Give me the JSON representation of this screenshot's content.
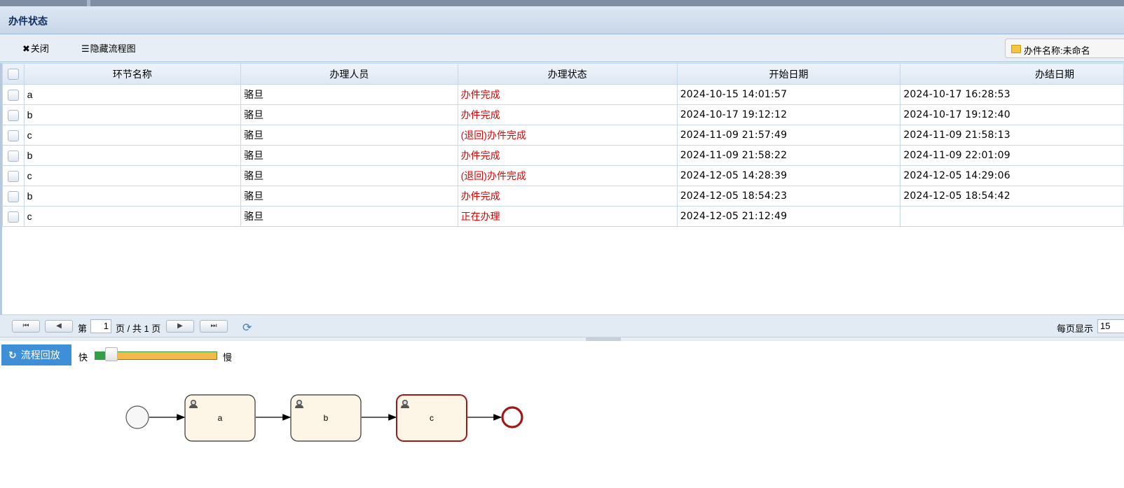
{
  "panel": {
    "title": "办件状态"
  },
  "toolbar": {
    "close_label": "关闭",
    "hide_label": "隐藏流程图",
    "file_name_label": "办件名称:未命名"
  },
  "grid": {
    "columns": [
      "环节名称",
      "办理人员",
      "办理状态",
      "开始日期",
      "办结日期"
    ],
    "rows": [
      {
        "step": "a",
        "handler": "骆旦",
        "status": "办件完成",
        "start": "2024-10-15 14:01:57",
        "end": "2024-10-17 16:28:53"
      },
      {
        "step": "b",
        "handler": "骆旦",
        "status": "办件完成",
        "start": "2024-10-17 19:12:12",
        "end": "2024-10-17 19:12:40"
      },
      {
        "step": "c",
        "handler": "骆旦",
        "status": "(退回)办件完成",
        "start": "2024-11-09 21:57:49",
        "end": "2024-11-09 21:58:13"
      },
      {
        "step": "b",
        "handler": "骆旦",
        "status": "办件完成",
        "start": "2024-11-09 21:58:22",
        "end": "2024-11-09 22:01:09"
      },
      {
        "step": "c",
        "handler": "骆旦",
        "status": "(退回)办件完成",
        "start": "2024-12-05 14:28:39",
        "end": "2024-12-05 14:29:06"
      },
      {
        "step": "b",
        "handler": "骆旦",
        "status": "办件完成",
        "start": "2024-12-05 18:54:23",
        "end": "2024-12-05 18:54:42"
      },
      {
        "step": "c",
        "handler": "骆旦",
        "status": "正在办理",
        "start": "2024-12-05 21:12:49",
        "end": ""
      }
    ]
  },
  "pager": {
    "page_prefix": "第",
    "current_page": "1",
    "page_suffix": "页 / 共 1 页",
    "per_page_label": "每页显示",
    "per_page_value": "15"
  },
  "replay": {
    "button_label": "流程回放",
    "fast_label": "快",
    "slow_label": "慢",
    "speed_fraction": 0.08
  },
  "flow": {
    "nodes": [
      "a",
      "b",
      "c"
    ],
    "active_node": "c"
  },
  "colors": {
    "status_red": "#e50000",
    "accent_blue": "#3d8fd8",
    "task_fill": "#fdf5e5",
    "end_event": "#a01818"
  }
}
